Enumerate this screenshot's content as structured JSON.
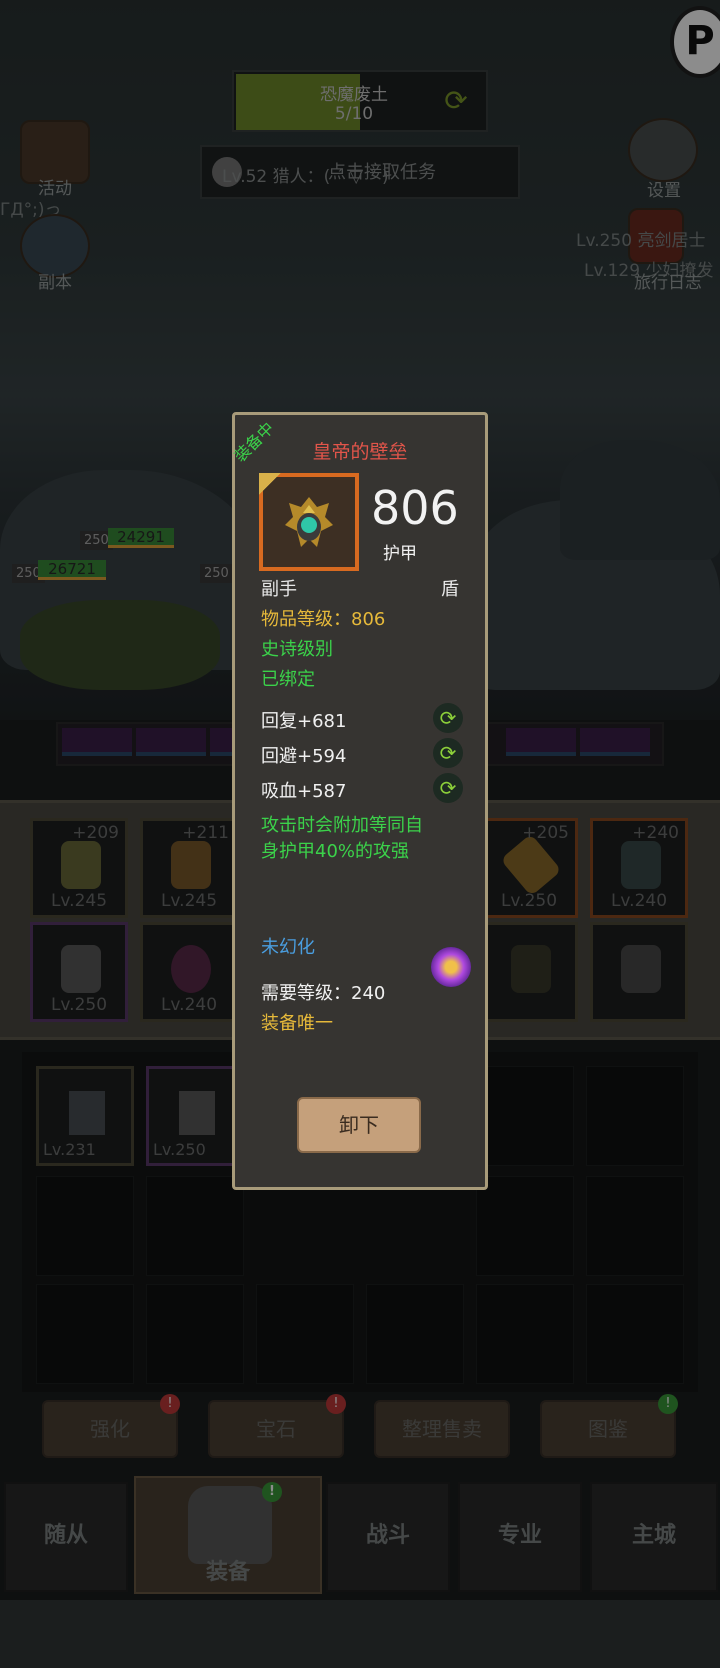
{
  "hud": {
    "zone_name": "恐魔废土",
    "zone_progress": "5/10",
    "quest_level": "Lv.52 猎人：( ´ ▽ ` )",
    "quest_action": "点击接取任务",
    "activity_label": "活动",
    "dungeon_label": "副本",
    "settings_label": "设置",
    "travel_log_label": "旅行日志",
    "chat_left": "ГД°;)っ",
    "chat_right_1": "Lv.250 亮剑居士",
    "chat_right_2": "Lv.129 少妇撩发",
    "hp_1_level": "250",
    "hp_1_value": "24291",
    "hp_2_level": "250",
    "hp_2_value": "26721",
    "hp_3_level": "250"
  },
  "equip_slots": [
    {
      "plus": "+209",
      "level": "Lv.245"
    },
    {
      "plus": "+211",
      "level": "Lv.245"
    },
    {
      "plus": "+205",
      "level": "Lv.250"
    },
    {
      "plus": "+240",
      "level": "Lv.240"
    },
    {
      "plus": "",
      "level": "Lv.250"
    },
    {
      "plus": "",
      "level": "Lv.240"
    }
  ],
  "inventory": [
    {
      "level": "Lv.231"
    },
    {
      "level": "Lv.250"
    }
  ],
  "bottom_buttons": {
    "enhance": "强化",
    "gem": "宝石",
    "sort_sell": "整理售卖",
    "codex": "图鉴"
  },
  "tabs": {
    "followers": "随从",
    "equipment": "装备",
    "battle": "战斗",
    "profession": "专业",
    "main_city": "主城"
  },
  "item": {
    "equipped_tag": "装备中",
    "name": "皇帝的壁垒",
    "armor_value": "806",
    "armor_label": "护甲",
    "slot": "副手",
    "type": "盾",
    "item_level": "物品等级：806",
    "rarity": "史诗级别",
    "bound": "已绑定",
    "stats": [
      "回复+681",
      "回避+594",
      "吸血+587"
    ],
    "effect": "攻击时会附加等同自身护甲40%的攻强",
    "transmog": "未幻化",
    "required_level": "需要等级：240",
    "unique": "装备唯一",
    "unequip_button": "卸下"
  },
  "colors": {
    "item_name": "#e2554a",
    "rarity_green": "#3bd24a",
    "item_level_gold": "#e6b93a",
    "transmog_blue": "#4a9ee0",
    "popup_border": "#a89b7a"
  }
}
